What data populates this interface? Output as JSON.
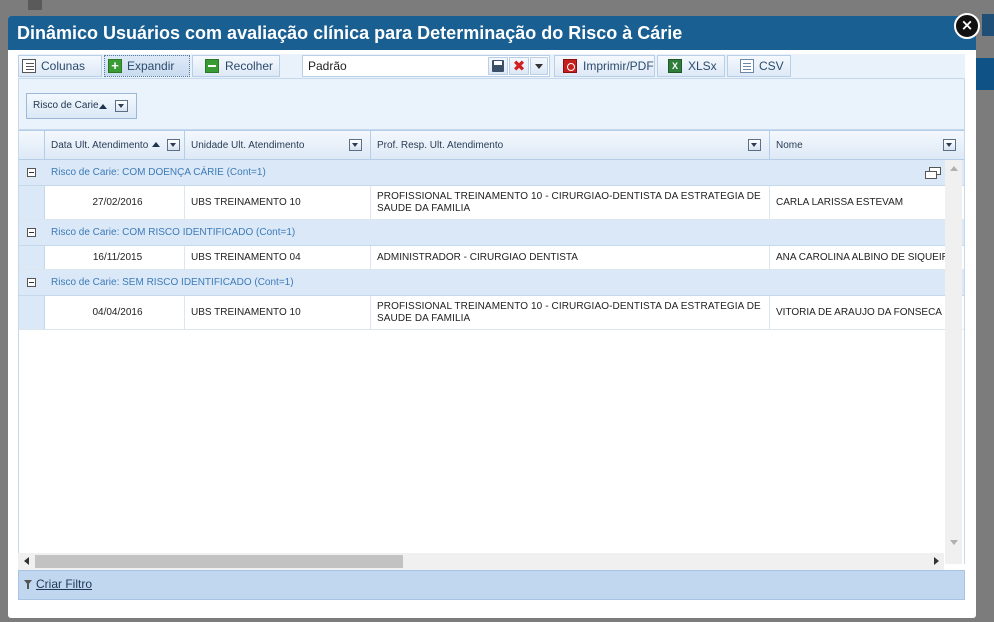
{
  "dialog": {
    "title": "Dinâmico Usuários com avaliação clínica para Determinação do Risco à Cárie",
    "close_label": "×"
  },
  "toolbar": {
    "columns_label": "Colunas",
    "expand_label": "Expandir",
    "collapse_label": "Recolher",
    "layout_value": "Padrão",
    "pdf_label": "Imprimir/PDF",
    "xlsx_label": "XLSx",
    "csv_label": "CSV"
  },
  "group_panel": {
    "chip_label": "Risco de Carie"
  },
  "grid": {
    "columns": [
      "Data Ult. Atendimento",
      "Unidade Ult. Atendimento",
      "Prof. Resp. Ult. Atendimento",
      "Nome"
    ],
    "groups": [
      {
        "label": "Risco de Carie: COM DOENÇA CÁRIE (Cont=1)",
        "rows": [
          [
            "27/02/2016",
            "UBS TREINAMENTO 10",
            "PROFISSIONAL TREINAMENTO 10 - CIRURGIAO-DENTISTA DA ESTRATEGIA DE SAUDE DA FAMILIA",
            "CARLA LARISSA ESTEVAM"
          ]
        ]
      },
      {
        "label": "Risco de Carie: COM RISCO IDENTIFICADO (Cont=1)",
        "rows": [
          [
            "16/11/2015",
            "UBS TREINAMENTO 04",
            "ADMINISTRADOR - CIRURGIAO DENTISTA",
            "ANA CAROLINA ALBINO DE SIQUEIRA"
          ]
        ]
      },
      {
        "label": "Risco de Carie: SEM RISCO IDENTIFICADO (Cont=1)",
        "rows": [
          [
            "04/04/2016",
            "UBS TREINAMENTO 10",
            "PROFISSIONAL TREINAMENTO 10 - CIRURGIAO-DENTISTA DA ESTRATEGIA DE SAUDE DA FAMILIA",
            "VITORIA DE ARAUJO DA FONSECA"
          ]
        ]
      }
    ]
  },
  "footer": {
    "create_filter_label": "Criar Filtro"
  }
}
